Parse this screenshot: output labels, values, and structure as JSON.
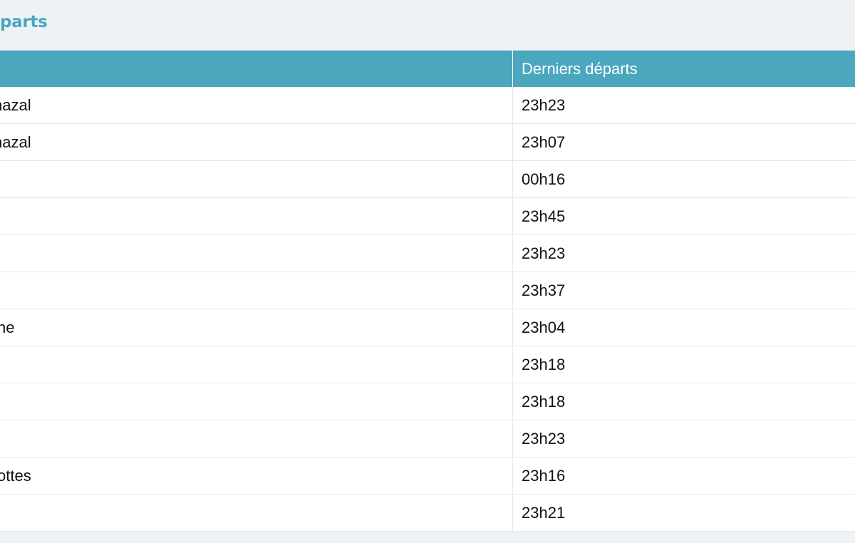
{
  "section": {
    "title": "parts"
  },
  "table": {
    "columns": [
      "",
      "Derniers départs"
    ],
    "rows": [
      {
        "name": "hazal",
        "time": "23h23"
      },
      {
        "name": "hazal",
        "time": "23h07"
      },
      {
        "name": "",
        "time": "00h16"
      },
      {
        "name": "",
        "time": "23h45"
      },
      {
        "name": "",
        "time": "23h23"
      },
      {
        "name": "",
        "time": "23h37"
      },
      {
        "name": "ne",
        "time": "23h04"
      },
      {
        "name": "",
        "time": "23h18"
      },
      {
        "name": "",
        "time": "23h18"
      },
      {
        "name": "",
        "time": "23h23"
      },
      {
        "name": "ottes",
        "time": "23h16"
      },
      {
        "name": "",
        "time": "23h21"
      }
    ]
  },
  "colors": {
    "accent": "#4aa7be",
    "page_background": "#eef2f4",
    "row_background": "#ffffff",
    "border": "#e3e8eb"
  }
}
